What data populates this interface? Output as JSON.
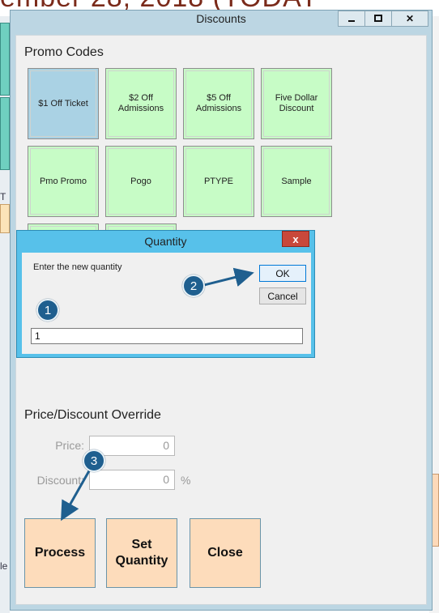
{
  "background": {
    "title": "ember 28, 2018 (TODAY",
    "left_text_1": "T",
    "left_text_2": "le"
  },
  "window": {
    "title": "Discounts",
    "min_icon": "minimize-icon",
    "max_icon": "maximize-icon",
    "close_glyph": "✕"
  },
  "promo": {
    "label": "Promo Codes",
    "tiles": [
      {
        "label": "$1 Off Ticket",
        "selected": true
      },
      {
        "label": "$2 Off Admissions"
      },
      {
        "label": "$5 Off Admissions"
      },
      {
        "label": "Five Dollar Discount"
      },
      {
        "label": "Pmo Promo"
      },
      {
        "label": "Pogo"
      },
      {
        "label": "PTYPE"
      },
      {
        "label": "Sample"
      }
    ]
  },
  "override": {
    "label": "Price/Discount Override",
    "price_label": "Price:",
    "price_value": "0",
    "discount_label": "Discount:",
    "discount_value": "0",
    "discount_unit": "%"
  },
  "actions": {
    "process": "Process",
    "set_quantity": "Set Quantity",
    "close": "Close"
  },
  "quantity_dialog": {
    "title": "Quantity",
    "close_glyph": "x",
    "prompt": "Enter the new quantity",
    "ok": "OK",
    "cancel": "Cancel",
    "value": "1"
  },
  "annotations": {
    "step1": "1",
    "step2": "2",
    "step3": "3",
    "color": "#1f5f8f"
  }
}
